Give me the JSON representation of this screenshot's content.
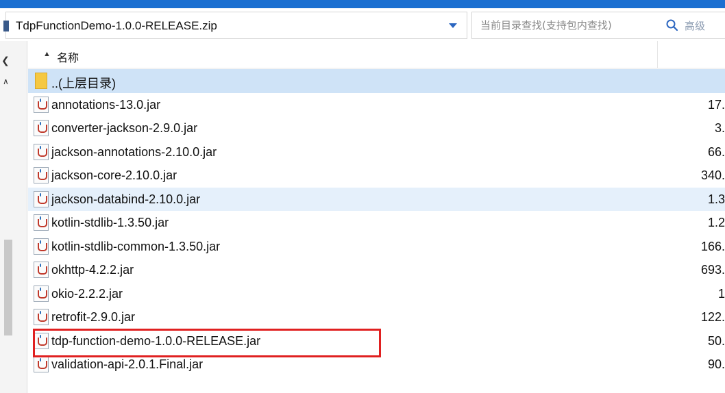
{
  "window": {
    "accent": "#1a6fd1"
  },
  "toolbar": {
    "path": "TdpFunctionDemo-1.0.0-RELEASE.zip",
    "search_placeholder": "当前目录查找(支持包内查找)",
    "advanced": "高级"
  },
  "header": {
    "name_label": "名称"
  },
  "parent_row": {
    "name": "..(上层目录)"
  },
  "files": [
    {
      "name": "annotations-13.0.jar",
      "size": "17."
    },
    {
      "name": "converter-jackson-2.9.0.jar",
      "size": "3."
    },
    {
      "name": "jackson-annotations-2.10.0.jar",
      "size": "66."
    },
    {
      "name": "jackson-core-2.10.0.jar",
      "size": "340."
    },
    {
      "name": "jackson-databind-2.10.0.jar",
      "size": "1.3"
    },
    {
      "name": "kotlin-stdlib-1.3.50.jar",
      "size": "1.2"
    },
    {
      "name": "kotlin-stdlib-common-1.3.50.jar",
      "size": "166."
    },
    {
      "name": "okhttp-4.2.2.jar",
      "size": "693."
    },
    {
      "name": "okio-2.2.2.jar",
      "size": "1"
    },
    {
      "name": "retrofit-2.9.0.jar",
      "size": "122."
    },
    {
      "name": "tdp-function-demo-1.0.0-RELEASE.jar",
      "size": "50."
    },
    {
      "name": "validation-api-2.0.1.Final.jar",
      "size": "90."
    }
  ],
  "highlighted_file": "tdp-function-demo-1.0.0-RELEASE.jar",
  "annotation_color": "#e02020"
}
